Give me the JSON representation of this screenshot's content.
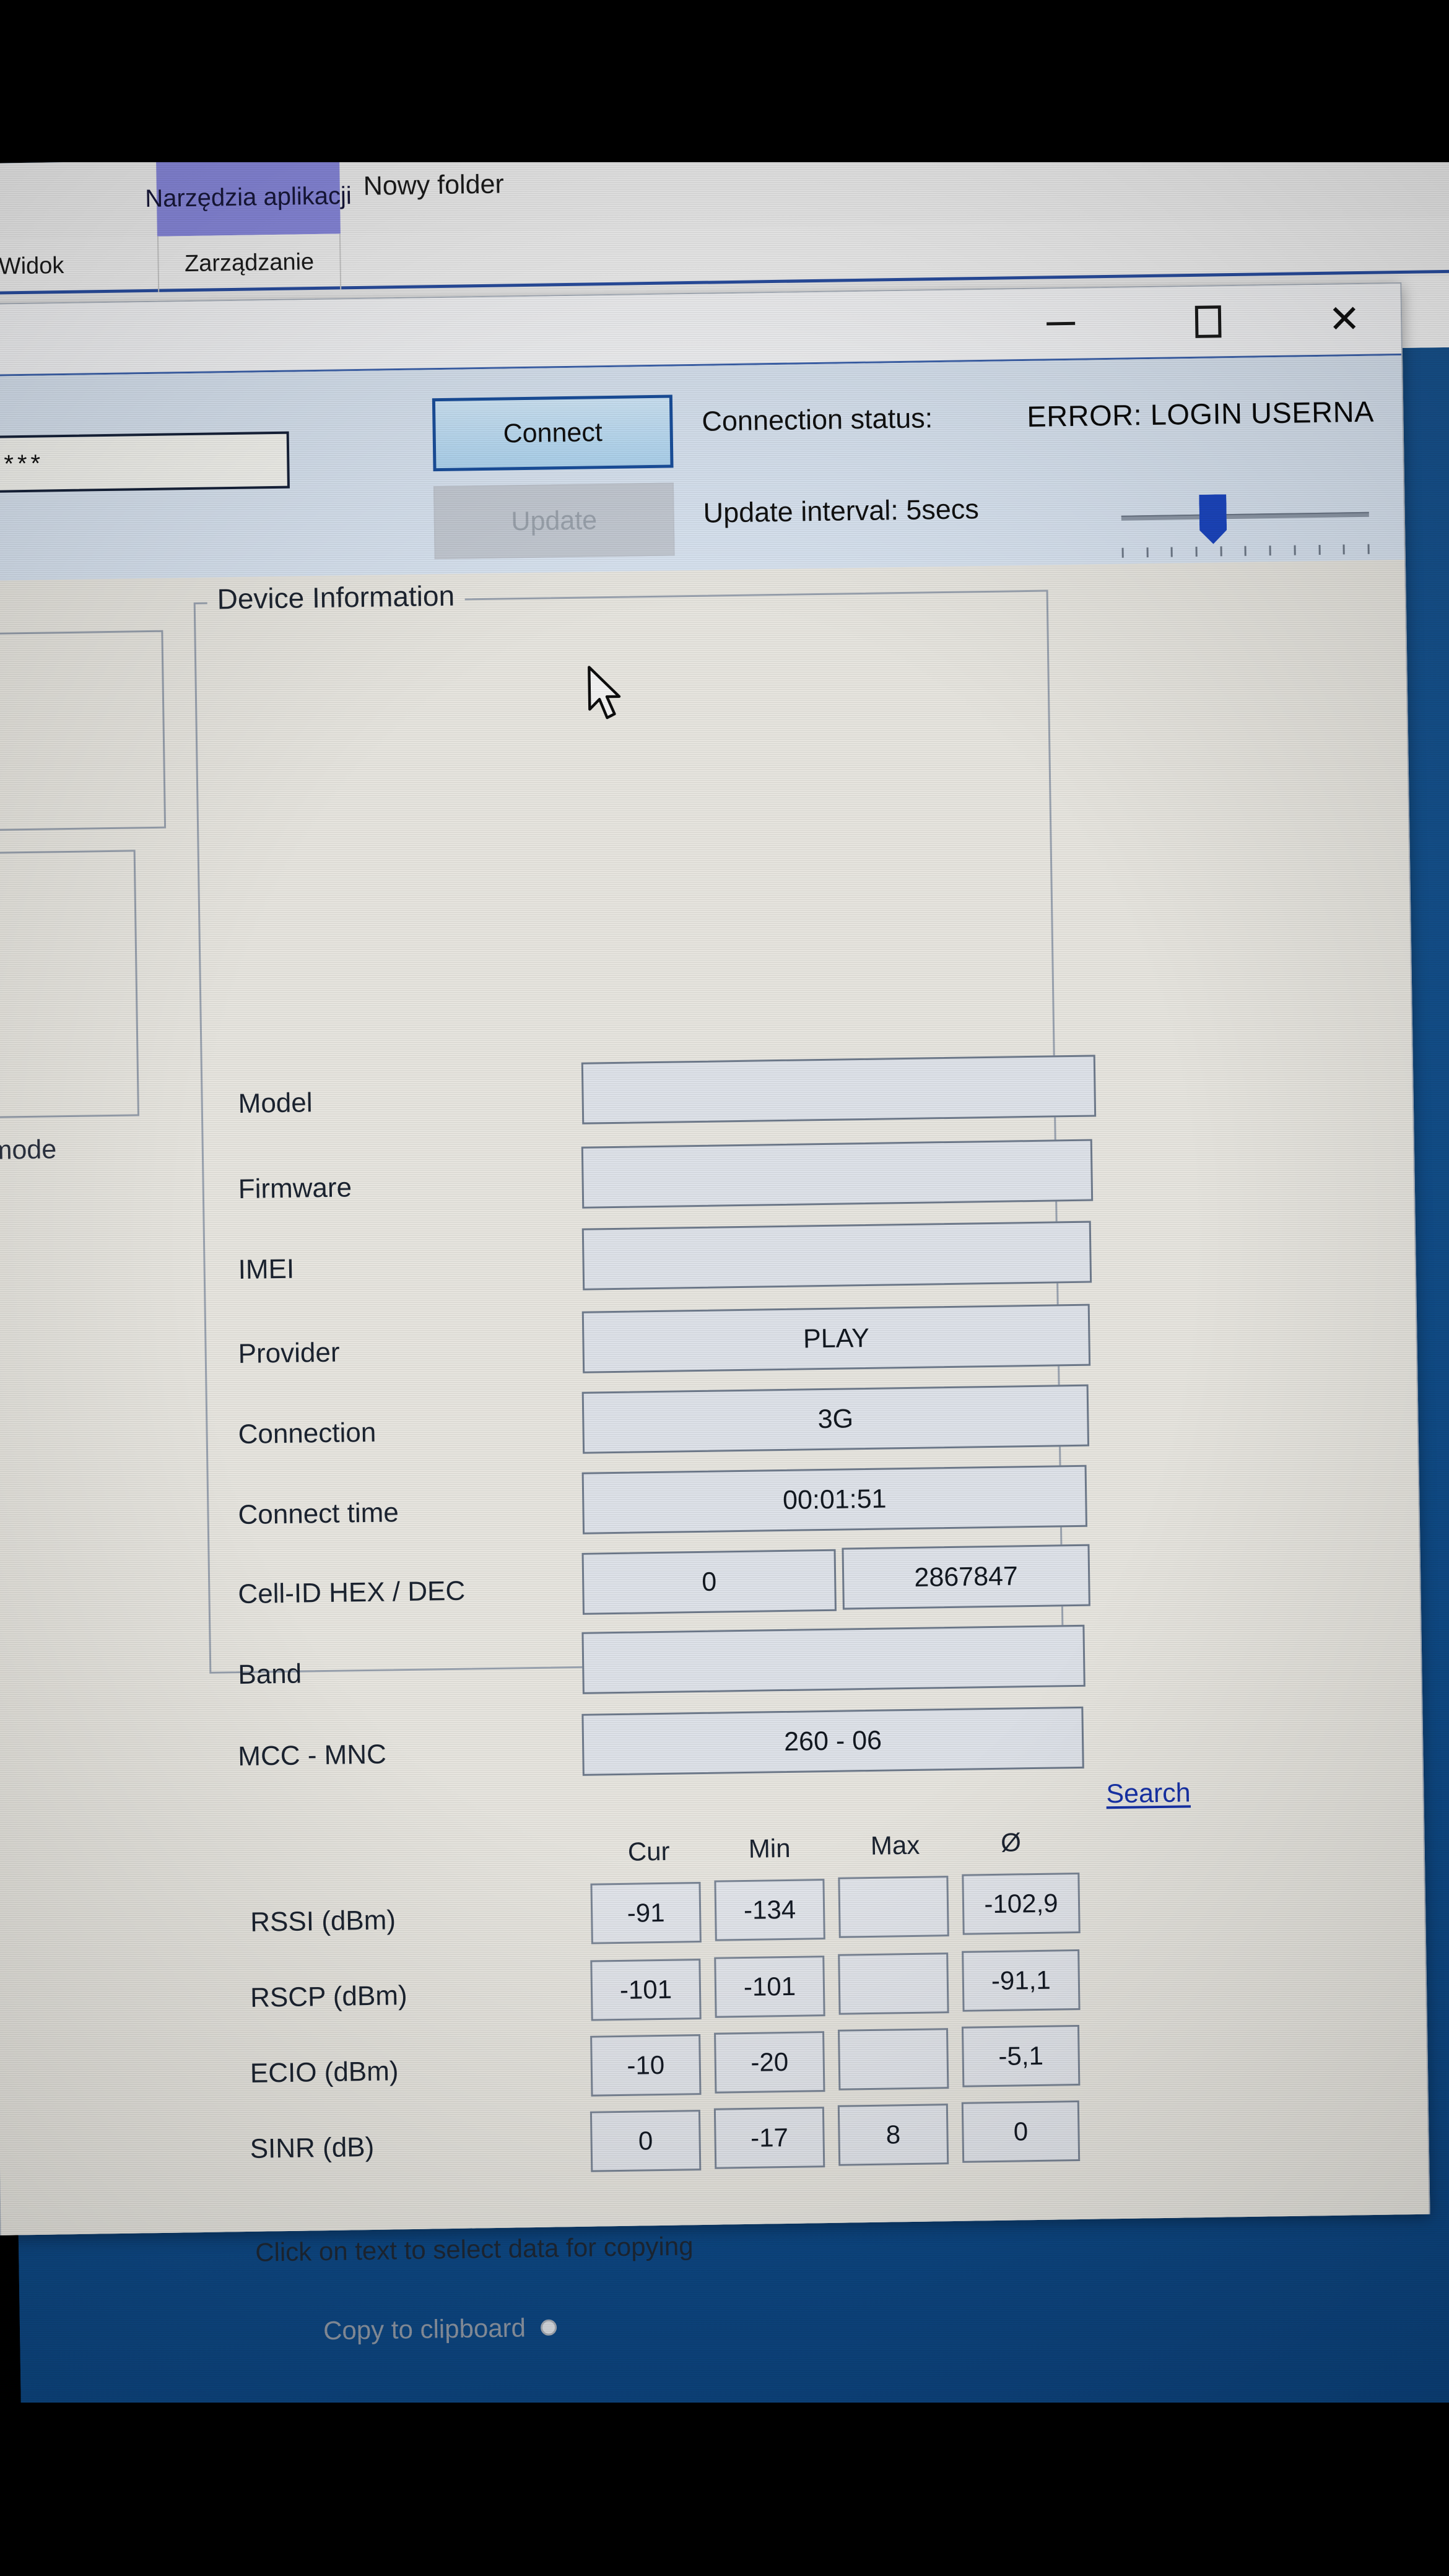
{
  "explorer": {
    "contextual_tab": "Narzędzia aplikacji",
    "window_title": "Nowy folder",
    "tabs": [
      {
        "label": "Widok"
      },
      {
        "label": "Zarządzanie"
      }
    ]
  },
  "window_controls": {
    "minimize": "minimize-icon",
    "maximize": "maximize-icon",
    "close": "✕"
  },
  "toolbar": {
    "password_value": "*****",
    "connect_label": "Connect",
    "update_label": "Update",
    "status_label": "Connection status:",
    "status_value": "ERROR: LOGIN USERNA",
    "interval_label": "Update interval: 5secs",
    "slider_tick_count": 11
  },
  "device_info": {
    "legend": "Device Information",
    "rows": [
      {
        "label": "Model",
        "value": ""
      },
      {
        "label": "Firmware",
        "value": ""
      },
      {
        "label": "IMEI",
        "value": ""
      },
      {
        "label": "Provider",
        "value": "PLAY"
      },
      {
        "label": "Connection",
        "value": "3G"
      },
      {
        "label": "Connect time",
        "value": "00:01:51"
      },
      {
        "label": "Cell-ID HEX / DEC",
        "value": "0",
        "value2": "2867847"
      },
      {
        "label": "Band",
        "value": ""
      },
      {
        "label": "MCC - MNC",
        "value": "260 - 06"
      }
    ],
    "search_link": "Search"
  },
  "metrics": {
    "columns": [
      "Cur",
      "Min",
      "Max",
      "Ø"
    ],
    "rows": [
      {
        "label": "RSSI (dBm)",
        "cur": "-91",
        "min": "-134",
        "max": "",
        "avg": "-102,9"
      },
      {
        "label": "RSCP (dBm)",
        "cur": "-101",
        "min": "-101",
        "max": "",
        "avg": "-91,1"
      },
      {
        "label": "ECIO (dBm)",
        "cur": "-10",
        "min": "-20",
        "max": "",
        "avg": "-5,1"
      },
      {
        "label": "SINR (dB)",
        "cur": "0",
        "min": "-17",
        "max": "8",
        "avg": "0"
      }
    ]
  },
  "footer": {
    "hint": "Click on text to select data for copying",
    "copy_label": "Copy to clipboard"
  },
  "side_panel": {
    "mode_label": "edmode"
  },
  "colors": {
    "desktop_blue": "#14528f",
    "contextual_tab_purple": "#8a8adf",
    "ribbon_accent": "#2a4fa3",
    "link_blue": "#1732a8",
    "connect_border": "#1a4f9c",
    "slider_thumb": "#1c46c0"
  }
}
